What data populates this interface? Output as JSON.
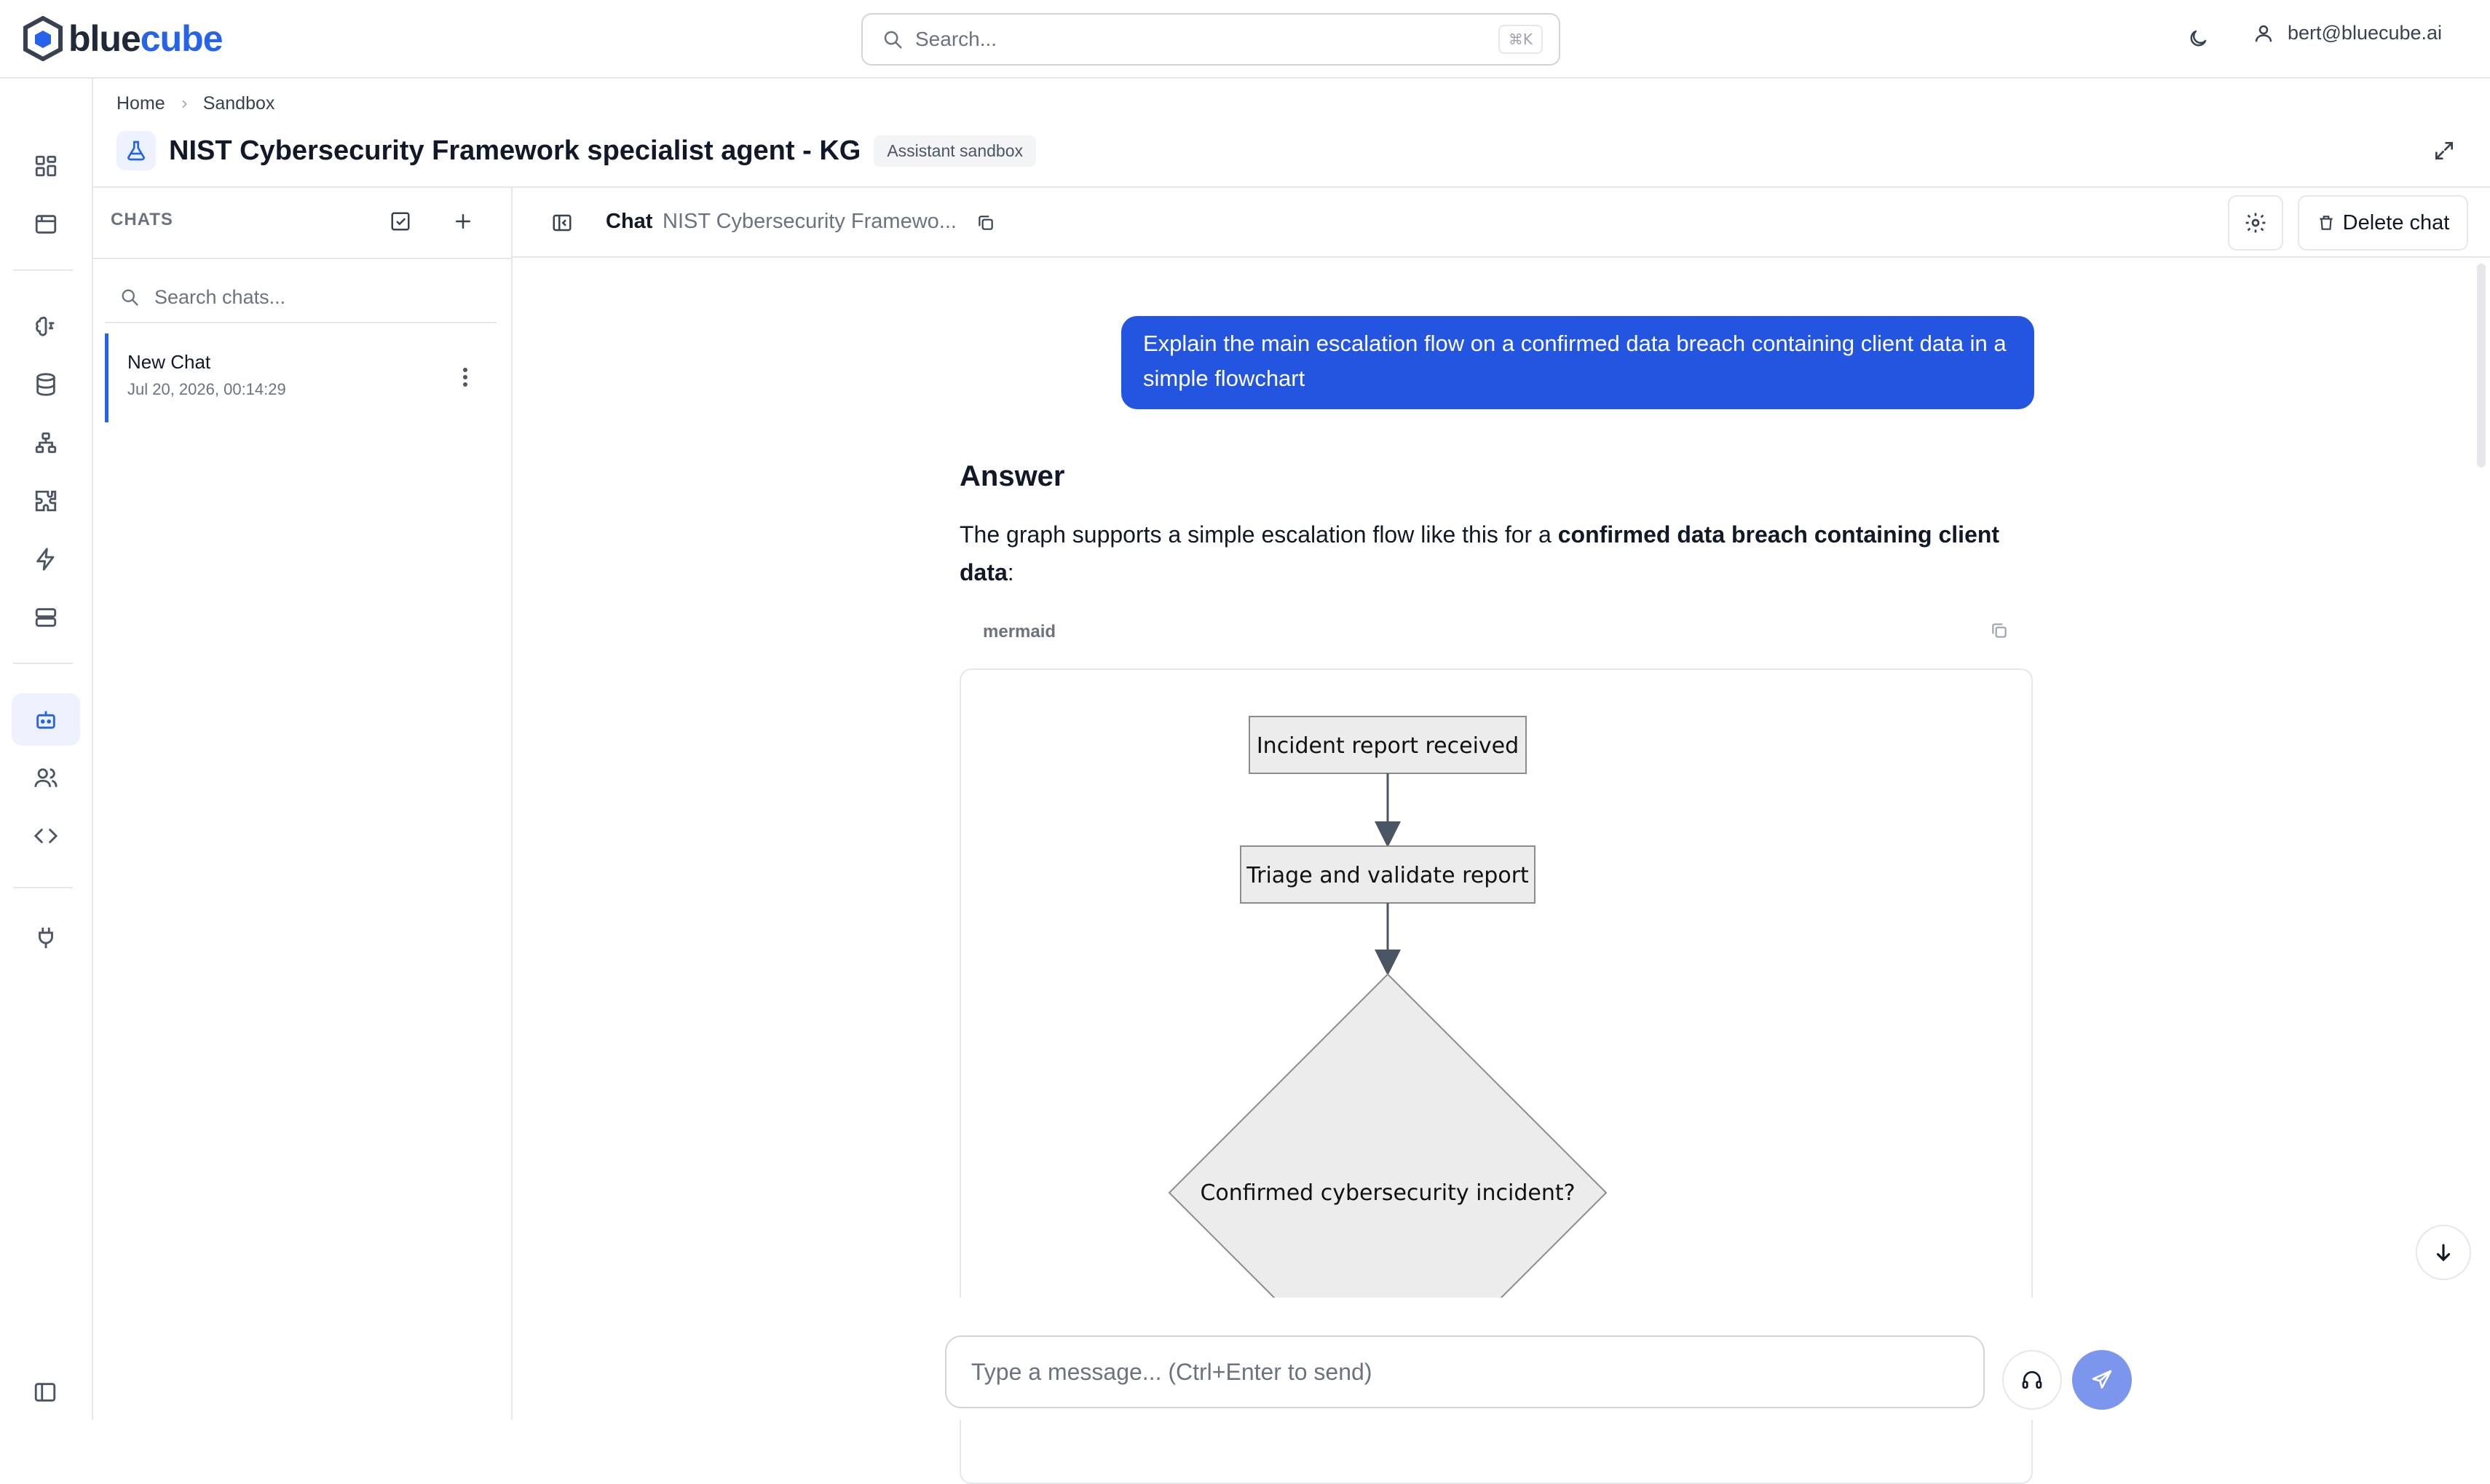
{
  "app": {
    "logo_text_a": "blue",
    "logo_text_b": "cube"
  },
  "topbar": {
    "search_placeholder": "Search...",
    "search_shortcut": "⌘K",
    "user_email": "bert@bluecube.ai"
  },
  "breadcrumb": {
    "items": [
      "Home",
      "Sandbox"
    ]
  },
  "page": {
    "title": "NIST Cybersecurity Framework specialist agent - KG",
    "badge": "Assistant sandbox"
  },
  "chats": {
    "heading": "CHATS",
    "search_placeholder": "Search chats...",
    "items": [
      {
        "name": "New Chat",
        "date": "Jul 20, 2026, 00:14:29"
      }
    ]
  },
  "chat": {
    "label": "Chat",
    "name": "NIST Cybersecurity Framewo...",
    "delete_label": "Delete chat",
    "user_message": "Explain the main escalation flow on a confirmed data breach containing client data in a simple flowchart",
    "answer_title": "Answer",
    "answer_text_before": "The graph supports a simple escalation flow like this for a ",
    "answer_text_bold": "confirmed data breach containing client data",
    "answer_text_after": ":",
    "code_language": "mermaid",
    "composer_placeholder": "Type a message... (Ctrl+Enter to send)"
  },
  "diagram": {
    "nodes": [
      {
        "id": "n1",
        "label": "Incident report received",
        "shape": "rect"
      },
      {
        "id": "n2",
        "label": "Triage and validate report",
        "shape": "rect"
      },
      {
        "id": "n3",
        "label": "Confirmed cybersecurity incident?",
        "shape": "diamond"
      }
    ],
    "edges": [
      [
        "n1",
        "n2"
      ],
      [
        "n2",
        "n3"
      ]
    ]
  },
  "colors": {
    "accent": "#2563eb",
    "user_bubble": "#2355e0",
    "node_fill": "#ececec",
    "node_stroke": "#8c8c8c",
    "send_button": "#7c96ee"
  },
  "icons": {
    "rail": [
      "dashboard-icon",
      "calendar-icon",
      "brain-icon",
      "database-icon",
      "sitemap-icon",
      "puzzle-icon",
      "lightning-icon",
      "server-icon",
      "bot-icon",
      "users-icon",
      "code-icon",
      "plug-icon",
      "sidebar-toggle-icon"
    ]
  }
}
